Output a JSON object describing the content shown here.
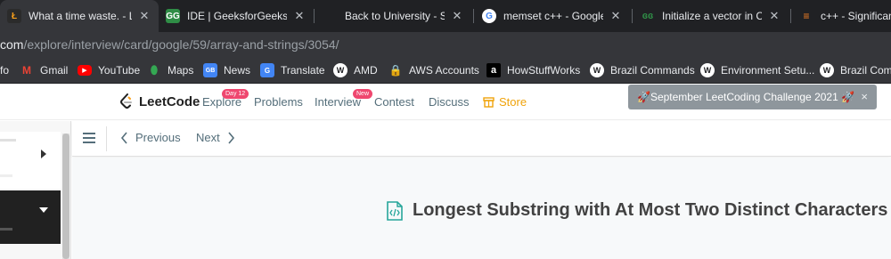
{
  "browser": {
    "tabs": [
      {
        "title": "What a time waste. - Lee",
        "active": true
      },
      {
        "title": "IDE | GeeksforGeeks | A"
      },
      {
        "title": "Back to University - Stu"
      },
      {
        "title": "memset c++ - Google S"
      },
      {
        "title": "Initialize a vector in C++"
      },
      {
        "title": "c++ - Significanc"
      }
    ],
    "url_host": "com",
    "url_path": "/explore/interview/card/google/59/array-and-strings/3054/",
    "bookmarks": [
      {
        "label": "fo"
      },
      {
        "label": "Gmail"
      },
      {
        "label": "YouTube"
      },
      {
        "label": "Maps"
      },
      {
        "label": "News"
      },
      {
        "label": "Translate"
      },
      {
        "label": "AMD"
      },
      {
        "label": "AWS Accounts"
      },
      {
        "label": "HowStuffWorks"
      },
      {
        "label": "Brazil Commands"
      },
      {
        "label": "Environment Setu..."
      },
      {
        "label": "Brazil Comm"
      }
    ]
  },
  "leetcode": {
    "logo_text": "LeetCode",
    "nav": {
      "explore": "Explore",
      "explore_badge": "Day 12",
      "problems": "Problems",
      "interview": "Interview",
      "interview_badge": "New",
      "contest": "Contest",
      "discuss": "Discuss",
      "store": "Store"
    },
    "challenge_banner": "🚀September LeetCoding Challenge 2021 🚀",
    "challenge_close": "×",
    "toolbar": {
      "previous": "Previous",
      "next": "Next"
    },
    "page_title": "Longest Substring with At Most Two Distinct Characters"
  },
  "colors": {
    "accent_orange": "#f0a30a",
    "badge_red": "#ef476f",
    "title_icon_teal": "#26a69a"
  }
}
